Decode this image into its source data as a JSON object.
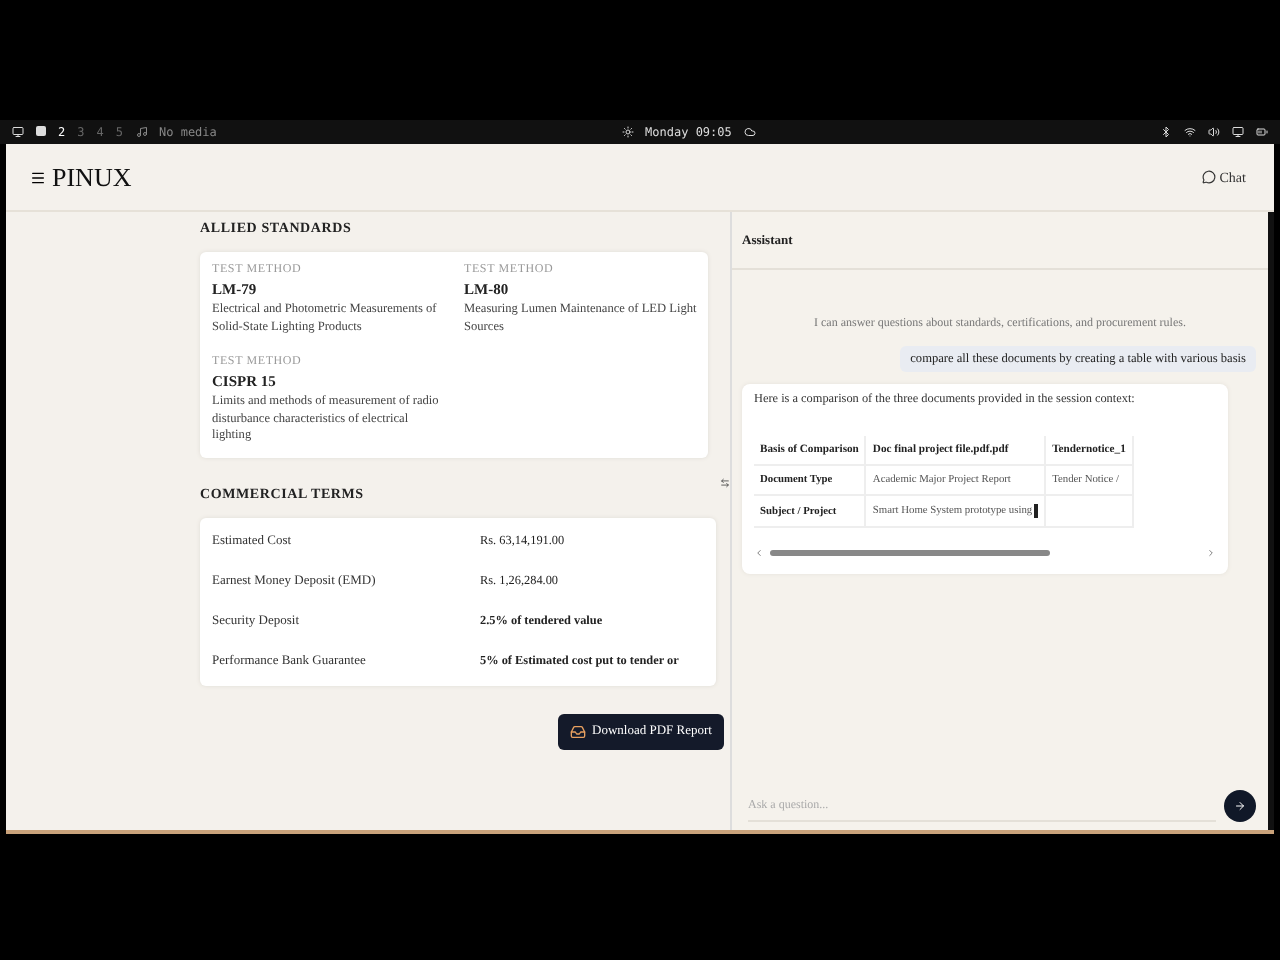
{
  "system_bar": {
    "workspaces": [
      {
        "label": "2",
        "selected": true
      },
      {
        "label": "3",
        "selected": false
      },
      {
        "label": "4",
        "selected": false
      },
      {
        "label": "5",
        "selected": false
      }
    ],
    "media": "No media",
    "clock": "Monday 09:05"
  },
  "header": {
    "logo": "PINUX",
    "chat_button": "Chat"
  },
  "allied_standards": {
    "title": "ALLIED STANDARDS",
    "items": [
      {
        "label": "TEST METHOD",
        "code": "LM-79",
        "description": "Electrical and Photometric Measurements of Solid-State Lighting Products"
      },
      {
        "label": "TEST METHOD",
        "code": "LM-80",
        "description": "Measuring Lumen Maintenance of LED Light Sources"
      },
      {
        "label": "TEST METHOD",
        "code": "CISPR 15",
        "description": "Limits and methods of measurement of radio disturbance characteristics of electrical lighting"
      }
    ]
  },
  "commercial_terms": {
    "title": "COMMERCIAL TERMS",
    "rows": [
      {
        "label": "Estimated Cost",
        "value": "Rs. 63,14,191.00",
        "emphasis": false
      },
      {
        "label": "Earnest Money Deposit (EMD)",
        "value": "Rs. 1,26,284.00",
        "emphasis": false
      },
      {
        "label": "Security Deposit",
        "value": "2.5% of tendered value",
        "emphasis": true
      },
      {
        "label": "Performance Bank Guarantee",
        "value": "5% of Estimated cost put to tender or",
        "emphasis": true
      }
    ]
  },
  "download_button": "Download PDF Report",
  "assistant": {
    "title": "Assistant",
    "intro": "I can answer questions about standards, certifications, and procurement rules.",
    "messages": [
      {
        "kind": "user",
        "text": "compare all these documents by creating a table with various basis"
      },
      {
        "kind": "assistant",
        "text": "Here is a comparison of the three documents provided in the session context:",
        "table": {
          "columns": [
            "Basis of Comparison",
            "Doc final project file.pdf.pdf",
            "Tendernotice_1"
          ],
          "rows": [
            [
              "Document Type",
              "Academic Major Project Report",
              "Tender Notice /"
            ],
            [
              "Subject / Project",
              "Smart Home System prototype using"
            ]
          ]
        },
        "streaming": true
      }
    ],
    "input": {
      "placeholder": "Ask a question..."
    }
  }
}
